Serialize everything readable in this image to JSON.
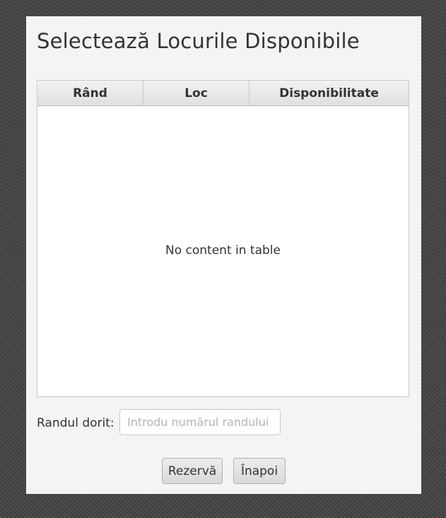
{
  "window": {
    "title": "Selectează Locurile Disponibile"
  },
  "table": {
    "columns": [
      "Rând",
      "Loc",
      "Disponibilitate"
    ],
    "rows": [],
    "empty_message": "No content in table"
  },
  "form": {
    "row_label": "Randul dorit:",
    "row_input_value": "",
    "row_input_placeholder": "Introdu numărul randului"
  },
  "buttons": {
    "reserve_label": "Rezervă",
    "back_label": "Înapoi"
  }
}
